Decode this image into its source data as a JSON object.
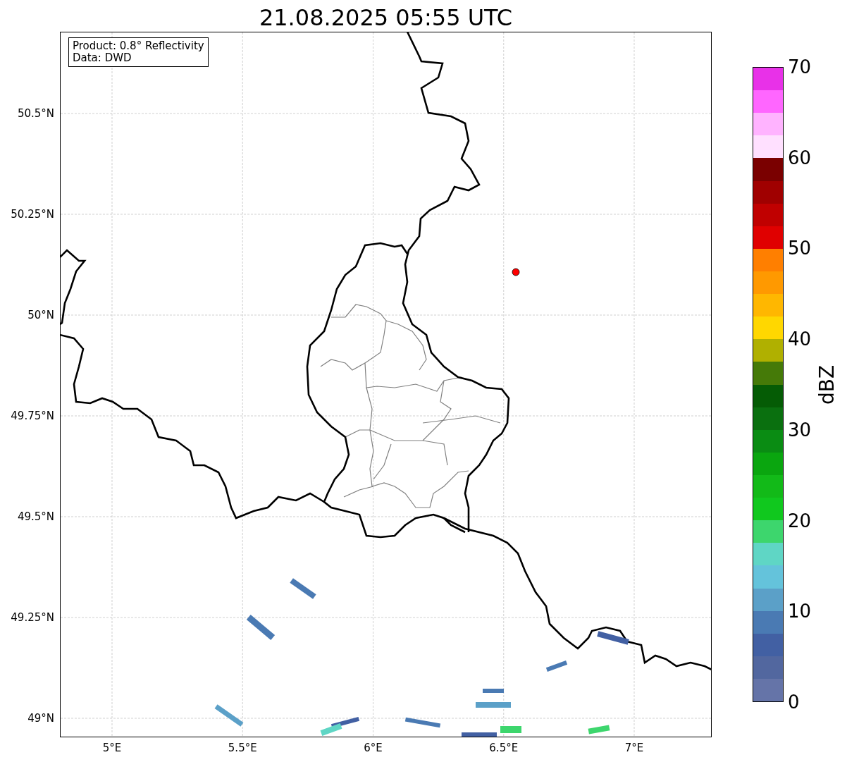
{
  "title": "21.08.2025 05:55 UTC",
  "legend": [
    "Product: 0.8° Reflectivity",
    "Data: DWD"
  ],
  "map": {
    "yticks": [
      "50.5°N",
      "50.25°N",
      "50°N",
      "49.75°N",
      "49.5°N",
      "49.25°N",
      "49°N"
    ],
    "xticks": [
      "5°E",
      "5.5°E",
      "6°E",
      "6.5°E",
      "7°E"
    ]
  },
  "colorbar": {
    "label": "dBZ",
    "ticks": [
      "70",
      "60",
      "50",
      "40",
      "30",
      "20",
      "10",
      "0"
    ],
    "bands": [
      {
        "color": "#e831e8"
      },
      {
        "color": "#ff66ff"
      },
      {
        "color": "#ffb3ff"
      },
      {
        "color": "#ffe0ff"
      },
      {
        "color": "#7a0000"
      },
      {
        "color": "#a00000"
      },
      {
        "color": "#c00000"
      },
      {
        "color": "#e00000"
      },
      {
        "color": "#ff7f00"
      },
      {
        "color": "#ff9900"
      },
      {
        "color": "#ffb700"
      },
      {
        "color": "#ffd700"
      },
      {
        "color": "#b0b000"
      },
      {
        "color": "#457a08"
      },
      {
        "color": "#055c05"
      },
      {
        "color": "#0a700f"
      },
      {
        "color": "#0a8c13"
      },
      {
        "color": "#0aa60f"
      },
      {
        "color": "#12ba18"
      },
      {
        "color": "#10c81e"
      },
      {
        "color": "#3dd66d"
      },
      {
        "color": "#5fd6c5"
      },
      {
        "color": "#64c3db"
      },
      {
        "color": "#5ba0c8"
      },
      {
        "color": "#4a7ab3"
      },
      {
        "color": "#4260a3"
      },
      {
        "color": "#52679f"
      },
      {
        "color": "#6574a8"
      }
    ]
  }
}
